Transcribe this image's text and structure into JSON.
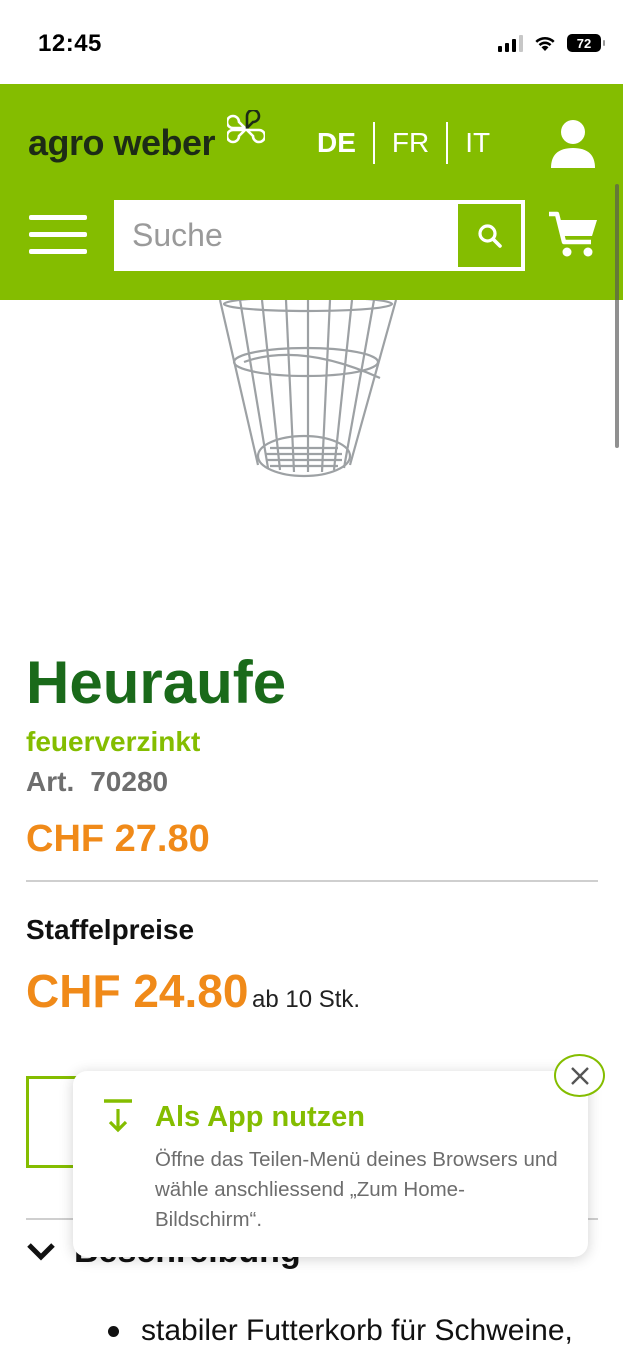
{
  "status_bar": {
    "time": "12:45",
    "battery": "72"
  },
  "header": {
    "logo_text": "agro weber",
    "languages": [
      {
        "label": "DE",
        "active": true
      },
      {
        "label": "FR",
        "active": false
      },
      {
        "label": "IT",
        "active": false
      }
    ],
    "search": {
      "placeholder": "Suche",
      "value": ""
    }
  },
  "product": {
    "title": "Heuraufe",
    "subtitle": "feuerverzinkt",
    "article_label": "Art.",
    "article_number": "70280",
    "price": "CHF 27.80",
    "tier_title": "Staffelpreise",
    "tier_price": "CHF 24.80",
    "tier_qty": "ab 10 Stk.",
    "description_label": "Beschreibung",
    "description_first_bullet": "stabiler Futterkorb für Schweine,"
  },
  "popup": {
    "title": "Als App nutzen",
    "text": "Öffne das Teilen-Menü deines Browsers und wähle anschliessend „Zum Home-Bildschirm“."
  },
  "colors": {
    "brand_green": "#84bd00",
    "title_green": "#1a6a1a",
    "price_orange": "#f08a19"
  },
  "icons": [
    "signal-icon",
    "wifi-icon",
    "battery-icon",
    "logo-clover-icon",
    "user-icon",
    "menu-icon",
    "search-icon",
    "cart-icon",
    "chevron-down-icon",
    "download-icon",
    "close-icon"
  ]
}
